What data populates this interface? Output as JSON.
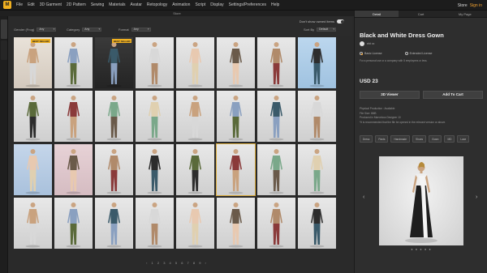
{
  "menu": {
    "items": [
      "File",
      "Edit",
      "3D Garment",
      "2D Pattern",
      "Sewing",
      "Materials",
      "Avatar",
      "Retopology",
      "Animation",
      "Script",
      "Display",
      "Settings/Preferences",
      "Help"
    ],
    "store_label": "Store",
    "signin_label": "Sign in"
  },
  "window": {
    "title": "Store"
  },
  "filters": {
    "toggle_label": "Don't show owned items",
    "gender": {
      "label": "Gender (Frog)",
      "value": "Any"
    },
    "category": {
      "label": "Category",
      "value": "Any"
    },
    "format": {
      "label": "Format",
      "value": "Any"
    },
    "sort": {
      "label": "Sort By",
      "value": "Default"
    }
  },
  "grid": {
    "items": [
      {
        "badge": "BEST SELLER",
        "bg": "warm"
      },
      {
        "badge": "",
        "bg": "light"
      },
      {
        "badge": "BEST SELLER",
        "bg": "dark"
      },
      {
        "badge": "",
        "bg": "light"
      },
      {
        "badge": "",
        "bg": "light"
      },
      {
        "badge": "",
        "bg": "light"
      },
      {
        "badge": "",
        "bg": "light"
      },
      {
        "badge": "",
        "bg": "blue"
      },
      {
        "badge": "",
        "bg": "light"
      },
      {
        "badge": "",
        "bg": "light"
      },
      {
        "badge": "",
        "bg": "light"
      },
      {
        "badge": "",
        "bg": "light"
      },
      {
        "badge": "",
        "bg": "light"
      },
      {
        "badge": "",
        "bg": "light"
      },
      {
        "badge": "",
        "bg": "light"
      },
      {
        "badge": "",
        "bg": "light"
      },
      {
        "badge": "",
        "bg": "lblue"
      },
      {
        "badge": "",
        "bg": "pink"
      },
      {
        "badge": "",
        "bg": "light"
      },
      {
        "badge": "",
        "bg": "light"
      },
      {
        "badge": "",
        "bg": "light"
      },
      {
        "badge": "",
        "bg": "light",
        "selected": true
      },
      {
        "badge": "",
        "bg": "light"
      },
      {
        "badge": "",
        "bg": "light"
      },
      {
        "badge": "",
        "bg": "light"
      },
      {
        "badge": "",
        "bg": "light"
      },
      {
        "badge": "",
        "bg": "light"
      },
      {
        "badge": "",
        "bg": "light"
      },
      {
        "badge": "",
        "bg": "light"
      },
      {
        "badge": "",
        "bg": "light"
      },
      {
        "badge": "",
        "bg": "light"
      },
      {
        "badge": "",
        "bg": "light"
      }
    ]
  },
  "pager": {
    "label": "‹ 1 2 3 4 5 6 7 8 9 ›"
  },
  "panel": {
    "tabs": [
      "Detail",
      "Cart",
      "My Page"
    ],
    "title": "Black and White Dress Gown",
    "author": "ebt xx",
    "license_basic": "Basic License",
    "license_extended": "Extended License",
    "note": "For a personal use or a company with 5 employees or less.",
    "price": "USD 23",
    "viewer_label": "3D Viewer",
    "cart_label": "Add To Cart",
    "info": [
      "Physical Production : Available",
      "File Size: 8MB",
      "Produced in Marvelous Designer 10",
      "*It is recommended that the file be opened in the relevant version or above."
    ],
    "tags": [
      "Dress",
      "Pants",
      "Handmade",
      "Shoes",
      "Gown",
      "MD",
      "Lace"
    ],
    "dots": "● ● ● ● ●"
  },
  "colors": {
    "accent": "#f0a030",
    "badge": "#f0b020",
    "panel_bg": "#2e2e2e",
    "app_bg": "#2a2a2a"
  },
  "icons": {
    "logo": "md-logo-icon",
    "toggle": "toggle-switch-icon",
    "prev": "chevron-left-icon",
    "next": "chevron-right-icon"
  }
}
